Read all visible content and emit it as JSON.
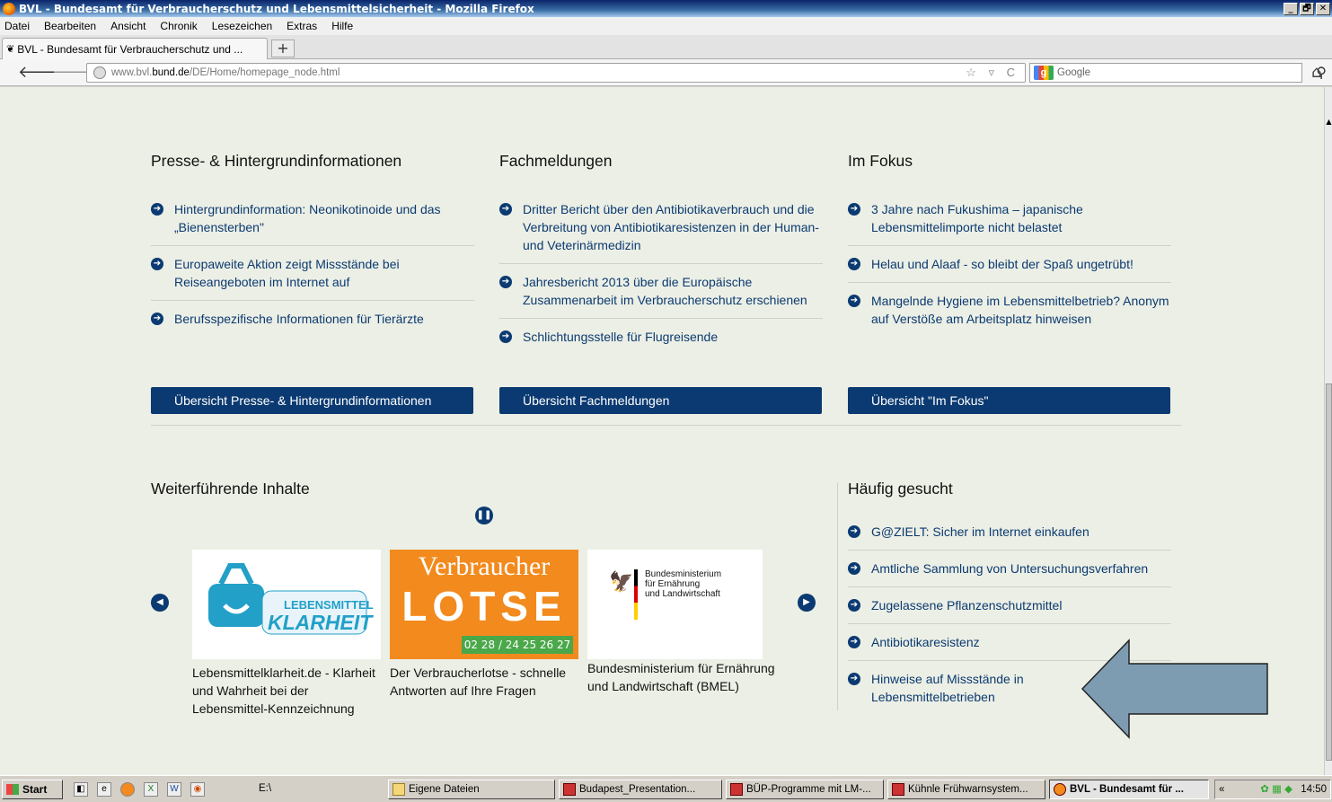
{
  "window": {
    "title": "BVL - Bundesamt für Verbraucherschutz und Lebensmittelsicherheit - Mozilla Firefox",
    "controls": [
      "_",
      "🗗",
      "✕"
    ]
  },
  "menubar": [
    "Datei",
    "Bearbeiten",
    "Ansicht",
    "Chronik",
    "Lesezeichen",
    "Extras",
    "Hilfe"
  ],
  "tab": {
    "label": "BVL - Bundesamt für Verbraucherschutz und ...",
    "new_tab": "+"
  },
  "navbar": {
    "url_prefix": "www.bvl.",
    "url_host": "bund.de",
    "url_path": "/DE/Home/homepage_node.html",
    "url_tools": "☆ ▿ C",
    "search_placeholder": "Google",
    "search_engine": "g"
  },
  "columns": [
    {
      "title": "Presse- & Hintergrundinformationen",
      "items": [
        "Hintergrundinformation: Neonikotinoide und das „Bienensterben\"",
        "Europaweite Aktion zeigt Missstände bei Reiseangeboten im Internet auf",
        "Berufsspezifische Informationen für Tierärzte"
      ],
      "button": "Übersicht Presse- & Hintergrundinformationen"
    },
    {
      "title": "Fachmeldungen",
      "items": [
        "Dritter Bericht über den Antibiotikaverbrauch und die Verbreitung von Antibiotikaresistenzen in der Human- und Veterinärmedizin",
        "Jahresbericht 2013 über die Europäische Zusammenarbeit im Verbraucherschutz erschienen",
        "Schlichtungsstelle für Flugreisende"
      ],
      "button": "Übersicht Fachmeldungen"
    },
    {
      "title": "Im Fokus",
      "items": [
        "3 Jahre nach Fukushima – japanische Lebensmittelimporte nicht belastet",
        "Helau und Alaaf - so bleibt der Spaß ungetrübt!",
        "Mangelnde Hygiene im Lebensmittelbetrieb? Anonym auf Verstöße am Arbeitsplatz hinweisen"
      ],
      "button": "Übersicht \"Im Fokus\""
    }
  ],
  "weiterfuehrend": {
    "title": "Weiterführende Inhalte",
    "teasers": [
      {
        "caption": "Lebensmittelklarheit.de - Klarheit und Wahrheit bei der Lebensmittel-Kennzeichnung",
        "logo_line1": "LEBENSMITTEL",
        "logo_line2": "KLARHEIT"
      },
      {
        "caption": "Der Verbraucherlotse - schnelle Antworten auf Ihre Fragen",
        "logo_line1": "Verbraucher",
        "logo_line2": "LOTSE",
        "phone": "02 28 / 24 25 26 27"
      },
      {
        "caption": "Bundesministerium für Ernährung und Landwirtschaft (BMEL)",
        "logo_text": "Bundesministerium\nfür Ernährung\nund Landwirtschaft"
      }
    ]
  },
  "haeufig": {
    "title": "Häufig gesucht",
    "items": [
      "G@ZIELT: Sicher im Internet einkaufen",
      "Amtliche Sammlung von Untersuchungsverfahren",
      "Zugelassene Pflanzenschutzmittel",
      "Antibiotikaresistenz",
      "Hinweise auf Missstände in Lebensmittelbetrieben"
    ]
  },
  "taskbar": {
    "start": "Start",
    "tasks": [
      "E:\\",
      "Eigene Dateien",
      "Budapest_Presentation...",
      "BÜP-Programme mit LM-...",
      "Kühnle Frühwarnsystem...",
      "BVL - Bundesamt für ..."
    ],
    "clock": "14:50",
    "tray_chevron": "«"
  },
  "colors": {
    "accent": "#0b3a72",
    "page_bg": "#ecefe5",
    "arrow_fill": "#7d9cb2"
  }
}
